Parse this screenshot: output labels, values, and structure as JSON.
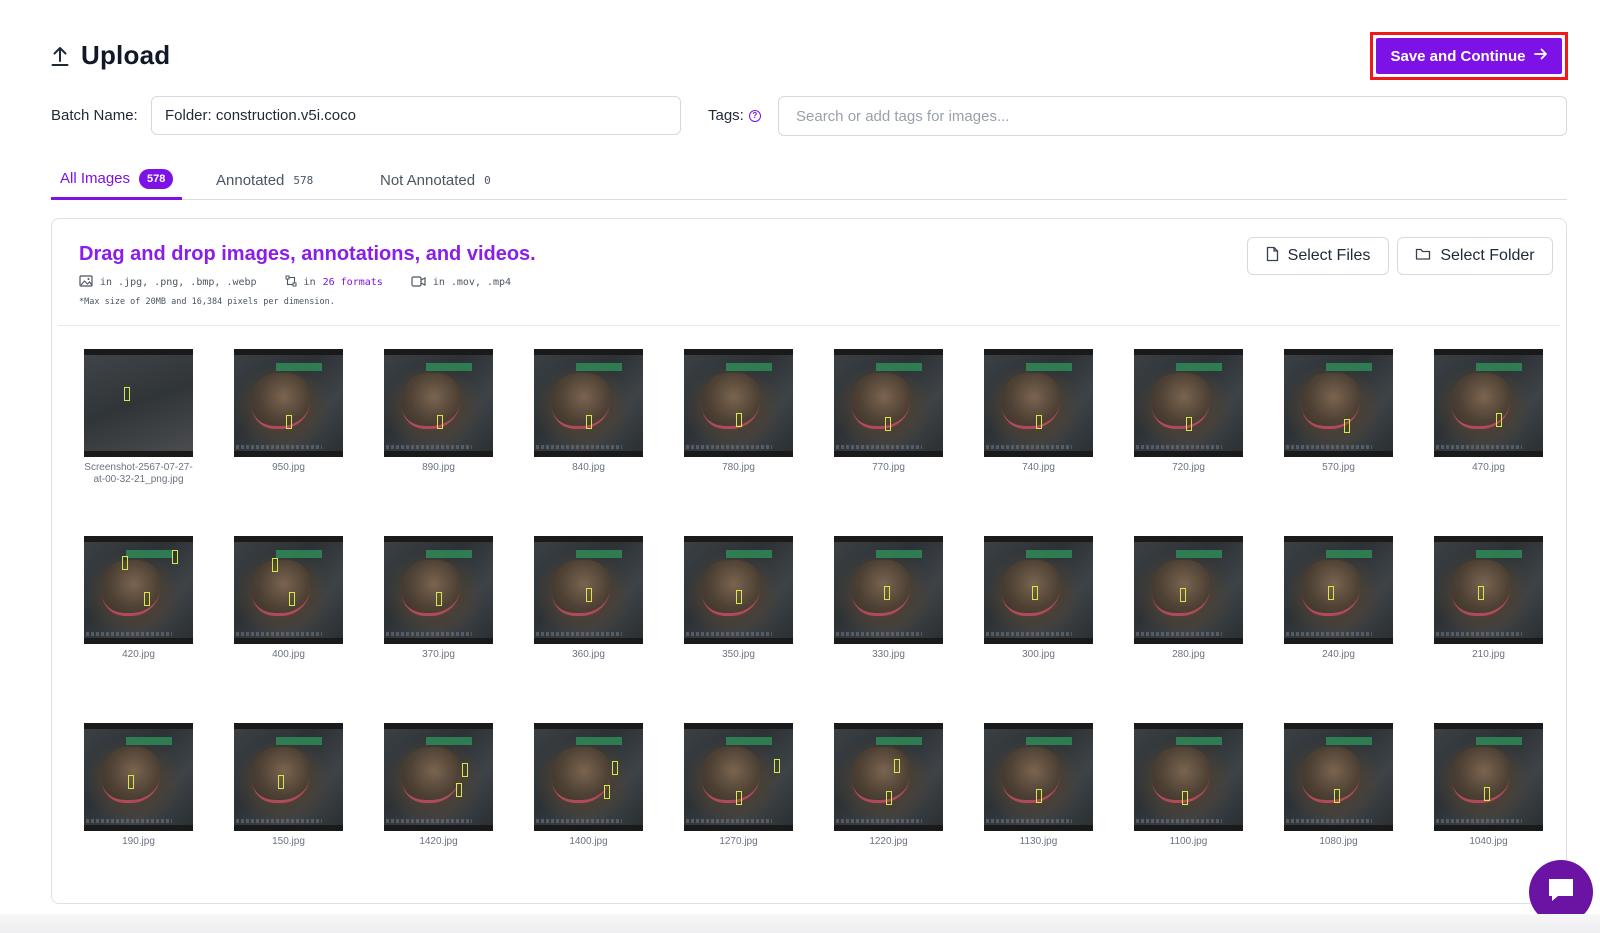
{
  "header": {
    "title": "Upload",
    "icon": "upload-icon"
  },
  "actions": {
    "save_label": "Save and Continue",
    "save_icon": "arrow-right-icon"
  },
  "form": {
    "batch_label": "Batch Name:",
    "batch_value": "Folder: construction.v5i.coco",
    "tags_label": "Tags:",
    "tags_placeholder": "Search or add tags for images..."
  },
  "tabs": [
    {
      "label": "All Images",
      "count": "578",
      "active": true
    },
    {
      "label": "Annotated",
      "count": "578",
      "active": false
    },
    {
      "label": "Not Annotated",
      "count": "0",
      "active": false
    }
  ],
  "dropzone": {
    "title": "Drag and drop images, annotations, and videos.",
    "image_formats": "in .jpg, .png, .bmp, .webp",
    "annotation_prefix": "in",
    "annotation_link": "26 formats",
    "video_formats": "in .mov, .mp4",
    "note": "*Max size of 20MB and 16,384 pixels per dimension.",
    "select_files_label": "Select Files",
    "select_folder_label": "Select Folder"
  },
  "thumbnails": [
    "Screenshot-2567-07-27-at-00-32-21_png.jpg",
    "950.jpg",
    "890.jpg",
    "840.jpg",
    "780.jpg",
    "770.jpg",
    "740.jpg",
    "720.jpg",
    "570.jpg",
    "470.jpg",
    "420.jpg",
    "400.jpg",
    "370.jpg",
    "360.jpg",
    "350.jpg",
    "330.jpg",
    "300.jpg",
    "280.jpg",
    "240.jpg",
    "210.jpg",
    "190.jpg",
    "150.jpg",
    "1420.jpg",
    "1400.jpg",
    "1270.jpg",
    "1220.jpg",
    "1130.jpg",
    "1100.jpg",
    "1080.jpg",
    "1040.jpg"
  ],
  "colors": {
    "accent": "#7c12e6",
    "highlight": "#f01818",
    "chat": "#6b14a3"
  }
}
